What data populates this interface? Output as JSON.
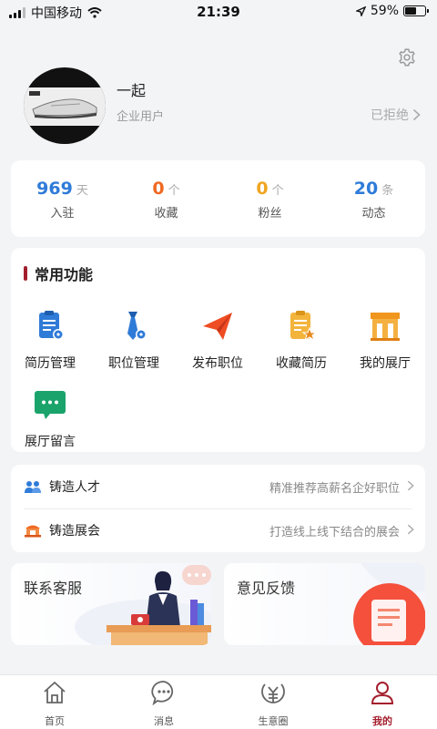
{
  "status_bar": {
    "carrier": "中国移动",
    "time": "21:39",
    "battery_text": "59%",
    "battery_level": 0.59
  },
  "profile": {
    "name": "一起",
    "type": "企业用户",
    "status": "已拒绝"
  },
  "stats": [
    {
      "value": "969",
      "unit": "天",
      "label": "入驻",
      "color": "#2f7bd8"
    },
    {
      "value": "0",
      "unit": "个",
      "label": "收藏",
      "color": "#ef6a23"
    },
    {
      "value": "0",
      "unit": "个",
      "label": "粉丝",
      "color": "#f0a521"
    },
    {
      "value": "20",
      "unit": "条",
      "label": "动态",
      "color": "#2f7bd8"
    }
  ],
  "functions": {
    "title": "常用功能",
    "items": [
      {
        "label": "简历管理",
        "icon": "resume-icon"
      },
      {
        "label": "职位管理",
        "icon": "tie-icon"
      },
      {
        "label": "发布职位",
        "icon": "paper-plane-icon"
      },
      {
        "label": "收藏简历",
        "icon": "starred-document-icon"
      },
      {
        "label": "我的展厅",
        "icon": "shop-icon"
      },
      {
        "label": "展厅留言",
        "icon": "chat-bubble-icon"
      }
    ]
  },
  "forge": [
    {
      "title": "铸造人才",
      "desc": "精准推荐高薪名企好职位",
      "icon": "people-icon"
    },
    {
      "title": "铸造展会",
      "desc": "打造线上线下结合的展会",
      "icon": "exhibition-icon"
    }
  ],
  "cards": {
    "service": "联系客服",
    "feedback": "意见反馈"
  },
  "tabs": [
    {
      "label": "首页",
      "icon": "home-icon",
      "active": false
    },
    {
      "label": "消息",
      "icon": "message-icon",
      "active": false
    },
    {
      "label": "生意圈",
      "icon": "business-circle-icon",
      "active": false
    },
    {
      "label": "我的",
      "icon": "user-icon",
      "active": true
    }
  ],
  "colors": {
    "accent": "#a41f2e",
    "blue": "#2f7bd8",
    "orange": "#ef6a23",
    "yellow": "#f0a521",
    "green": "#1aa36b"
  }
}
